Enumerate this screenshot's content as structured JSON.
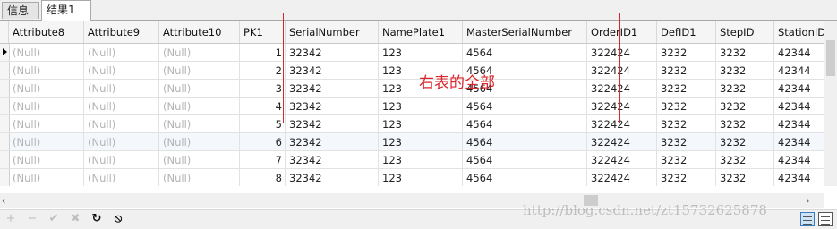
{
  "tabs": [
    {
      "label": "信息",
      "active": false
    },
    {
      "label": "结果1",
      "active": true
    }
  ],
  "columns": [
    "Attribute8",
    "Attribute9",
    "Attribute10",
    "PK1",
    "SerialNumber",
    "NamePlate1",
    "MasterSerialNumber",
    "OrderID1",
    "DefID1",
    "StepID",
    "StationID"
  ],
  "rows": [
    {
      "Attribute8": "(Null)",
      "Attribute9": "(Null)",
      "Attribute10": "(Null)",
      "PK1": "1",
      "SerialNumber": "32342",
      "NamePlate1": "123",
      "MasterSerialNumber": "4564",
      "OrderID1": "322424",
      "DefID1": "3232",
      "StepID": "3232",
      "StationID": "42344"
    },
    {
      "Attribute8": "(Null)",
      "Attribute9": "(Null)",
      "Attribute10": "(Null)",
      "PK1": "2",
      "SerialNumber": "32342",
      "NamePlate1": "123",
      "MasterSerialNumber": "4564",
      "OrderID1": "322424",
      "DefID1": "3232",
      "StepID": "3232",
      "StationID": "42344"
    },
    {
      "Attribute8": "(Null)",
      "Attribute9": "(Null)",
      "Attribute10": "(Null)",
      "PK1": "3",
      "SerialNumber": "32342",
      "NamePlate1": "123",
      "MasterSerialNumber": "4564",
      "OrderID1": "322424",
      "DefID1": "3232",
      "StepID": "3232",
      "StationID": "42344"
    },
    {
      "Attribute8": "(Null)",
      "Attribute9": "(Null)",
      "Attribute10": "(Null)",
      "PK1": "4",
      "SerialNumber": "32342",
      "NamePlate1": "123",
      "MasterSerialNumber": "4564",
      "OrderID1": "322424",
      "DefID1": "3232",
      "StepID": "3232",
      "StationID": "42344"
    },
    {
      "Attribute8": "(Null)",
      "Attribute9": "(Null)",
      "Attribute10": "(Null)",
      "PK1": "5",
      "SerialNumber": "32342",
      "NamePlate1": "123",
      "MasterSerialNumber": "4564",
      "OrderID1": "322424",
      "DefID1": "3232",
      "StepID": "3232",
      "StationID": "42344"
    },
    {
      "Attribute8": "(Null)",
      "Attribute9": "(Null)",
      "Attribute10": "(Null)",
      "PK1": "6",
      "SerialNumber": "32342",
      "NamePlate1": "123",
      "MasterSerialNumber": "4564",
      "OrderID1": "322424",
      "DefID1": "3232",
      "StepID": "3232",
      "StationID": "42344"
    },
    {
      "Attribute8": "(Null)",
      "Attribute9": "(Null)",
      "Attribute10": "(Null)",
      "PK1": "7",
      "SerialNumber": "32342",
      "NamePlate1": "123",
      "MasterSerialNumber": "4564",
      "OrderID1": "322424",
      "DefID1": "3232",
      "StepID": "3232",
      "StationID": "42344"
    },
    {
      "Attribute8": "(Null)",
      "Attribute9": "(Null)",
      "Attribute10": "(Null)",
      "PK1": "8",
      "SerialNumber": "32342",
      "NamePlate1": "123",
      "MasterSerialNumber": "4564",
      "OrderID1": "322424",
      "DefID1": "3232",
      "StepID": "3232",
      "StationID": "42344"
    }
  ],
  "current_row_index": 0,
  "highlighted_row_index": 5,
  "annotation": {
    "text": "右表的全部",
    "color": "#d9262c"
  },
  "toolbar": [
    "add-icon",
    "remove-icon",
    "apply-icon",
    "cancel-icon",
    "refresh-icon",
    "stop-icon"
  ],
  "watermark": "http://blog.csdn.net/zt15732625878"
}
